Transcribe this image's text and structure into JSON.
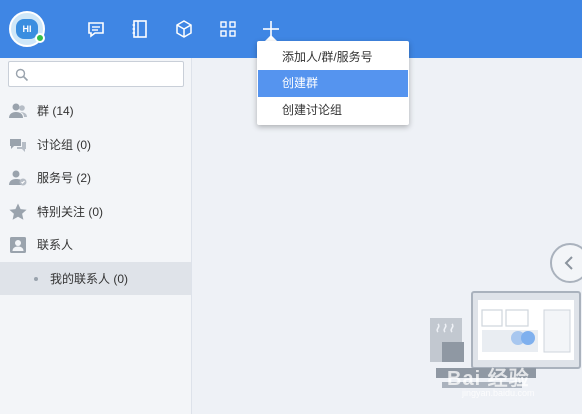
{
  "colors": {
    "topbar": "#3f86e4",
    "highlight": "#5594ef",
    "online": "#35c04a"
  },
  "avatar": {
    "text": "HI"
  },
  "toolbar": {
    "icons": [
      "message-icon",
      "contacts-book-icon",
      "cube-icon",
      "apps-grid-icon",
      "plus-icon"
    ]
  },
  "search": {
    "placeholder": "",
    "value": ""
  },
  "sidebar": {
    "items": [
      {
        "label": "群 (14)",
        "icon": "group-icon"
      },
      {
        "label": "讨论组 (0)",
        "icon": "discussion-icon"
      },
      {
        "label": "服务号 (2)",
        "icon": "service-account-icon"
      },
      {
        "label": "特别关注 (0)",
        "icon": "star-icon"
      },
      {
        "label": "联系人",
        "icon": "contact-card-icon"
      }
    ],
    "subitem": {
      "label": "我的联系人 (0)"
    }
  },
  "menu": {
    "items": [
      {
        "label": "添加人/群/服务号"
      },
      {
        "label": "创建群",
        "highlighted": true
      },
      {
        "label": "创建讨论组"
      }
    ]
  },
  "watermark": {
    "text": "Bai 经验",
    "url": "jingyan.baidu.com"
  }
}
